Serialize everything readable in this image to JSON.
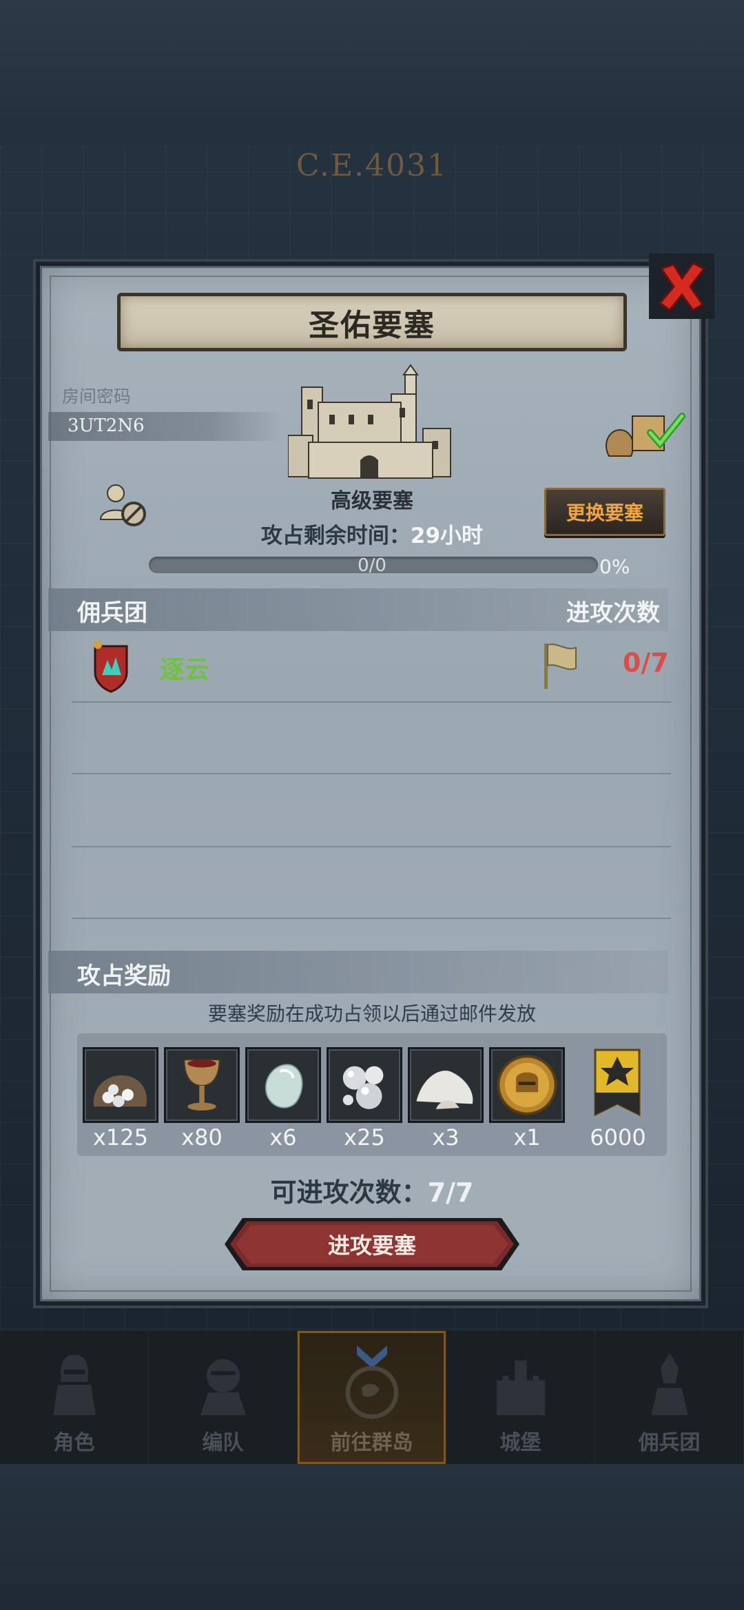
{
  "background": {
    "era_label": "C.E.4031"
  },
  "dialog": {
    "title": "圣佑要塞",
    "room_password_label": "房间密码",
    "room_password": "3UT2N6",
    "fortress_type": "高级要塞",
    "change_button": "更换要塞",
    "time_remaining_label": "攻占剩余时间：",
    "time_remaining_value": "29小时",
    "progress": {
      "count_text": "0/0",
      "percent_text": "0%",
      "fraction": 0
    },
    "mercenary_section": {
      "left_header": "佣兵团",
      "right_header": "进攻次数",
      "rows": [
        {
          "name": "逐云",
          "attacks": "0/7"
        }
      ]
    },
    "reward_section": {
      "header": "攻占奖励",
      "note": "要塞奖励在成功占领以后通过邮件发放",
      "items": [
        {
          "icon": "silver-ore-sack-icon",
          "qty": "x125"
        },
        {
          "icon": "goblet-icon",
          "qty": "x80"
        },
        {
          "icon": "gemstone-icon",
          "qty": "x6"
        },
        {
          "icon": "pearls-icon",
          "qty": "x25"
        },
        {
          "icon": "salt-pile-icon",
          "qty": "x3"
        },
        {
          "icon": "golden-helmet-medal-icon",
          "qty": "x1"
        },
        {
          "icon": "rank-banner-icon",
          "qty": "6000"
        }
      ]
    },
    "attempts_label": "可进攻次数：",
    "attempts_value": "7/7",
    "attack_button": "进攻要塞"
  },
  "nav": {
    "items": [
      {
        "label": "角色",
        "icon": "knight-icon",
        "active": false
      },
      {
        "label": "编队",
        "icon": "formation-icon",
        "active": false
      },
      {
        "label": "前往群岛",
        "icon": "islands-compass-icon",
        "active": true
      },
      {
        "label": "城堡",
        "icon": "castle-icon",
        "active": false
      },
      {
        "label": "佣兵团",
        "icon": "mercenary-icon",
        "active": false
      }
    ]
  },
  "colors": {
    "accent_orange": "#f0a640",
    "merc_green": "#6ec23c",
    "attack_red": "#d94e48",
    "button_red": "#7a2a2a",
    "close_red": "#d42a22"
  }
}
